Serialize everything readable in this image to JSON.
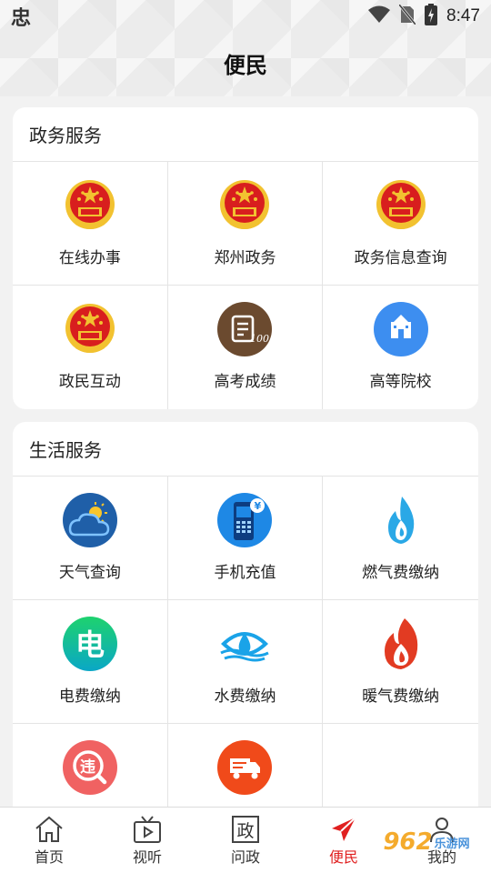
{
  "status_bar": {
    "app_glyph": "忠",
    "time": "8:47"
  },
  "header": {
    "title": "便民"
  },
  "gov_services": {
    "title": "政务服务",
    "items": [
      {
        "label": "在线办事",
        "icon": "national-emblem-icon"
      },
      {
        "label": "郑州政务",
        "icon": "national-emblem-icon"
      },
      {
        "label": "政务信息查询",
        "icon": "national-emblem-icon"
      },
      {
        "label": "政民互动",
        "icon": "national-emblem-icon"
      },
      {
        "label": "高考成绩",
        "icon": "exam-score-icon"
      },
      {
        "label": "高等院校",
        "icon": "university-icon"
      }
    ]
  },
  "life_services": {
    "title": "生活服务",
    "items": [
      {
        "label": "天气查询",
        "icon": "weather-icon"
      },
      {
        "label": "手机充值",
        "icon": "phone-recharge-icon"
      },
      {
        "label": "燃气费缴纳",
        "icon": "gas-flame-icon"
      },
      {
        "label": "电费缴纳",
        "icon": "electricity-icon"
      },
      {
        "label": "水费缴纳",
        "icon": "water-drop-icon"
      },
      {
        "label": "暖气费缴纳",
        "icon": "heating-flame-icon"
      },
      {
        "label": "",
        "icon": "traffic-violation-icon"
      },
      {
        "label": "",
        "icon": "truck-icon"
      }
    ]
  },
  "bottom_nav": {
    "items": [
      {
        "label": "首页",
        "icon": "home-icon"
      },
      {
        "label": "视听",
        "icon": "tv-play-icon"
      },
      {
        "label": "问政",
        "icon": "politics-icon",
        "glyph": "政"
      },
      {
        "label": "便民",
        "icon": "send-arrow-icon"
      },
      {
        "label": "我的",
        "icon": "user-icon"
      }
    ],
    "active_color": "#e02020"
  },
  "watermark": {
    "main": "962",
    "sub": "乐游网"
  },
  "colors": {
    "emblem_red": "#d81e1e",
    "emblem_gold": "#f2c230",
    "exam_brown": "#6b4a2f",
    "university_blue": "#3d8ef0",
    "weather_blue": "#1f5fa8",
    "phone_blue": "#1e88e5",
    "electric_green": "#14c4a0",
    "violation_red": "#f06262",
    "truck_orange": "#f04a1a"
  }
}
